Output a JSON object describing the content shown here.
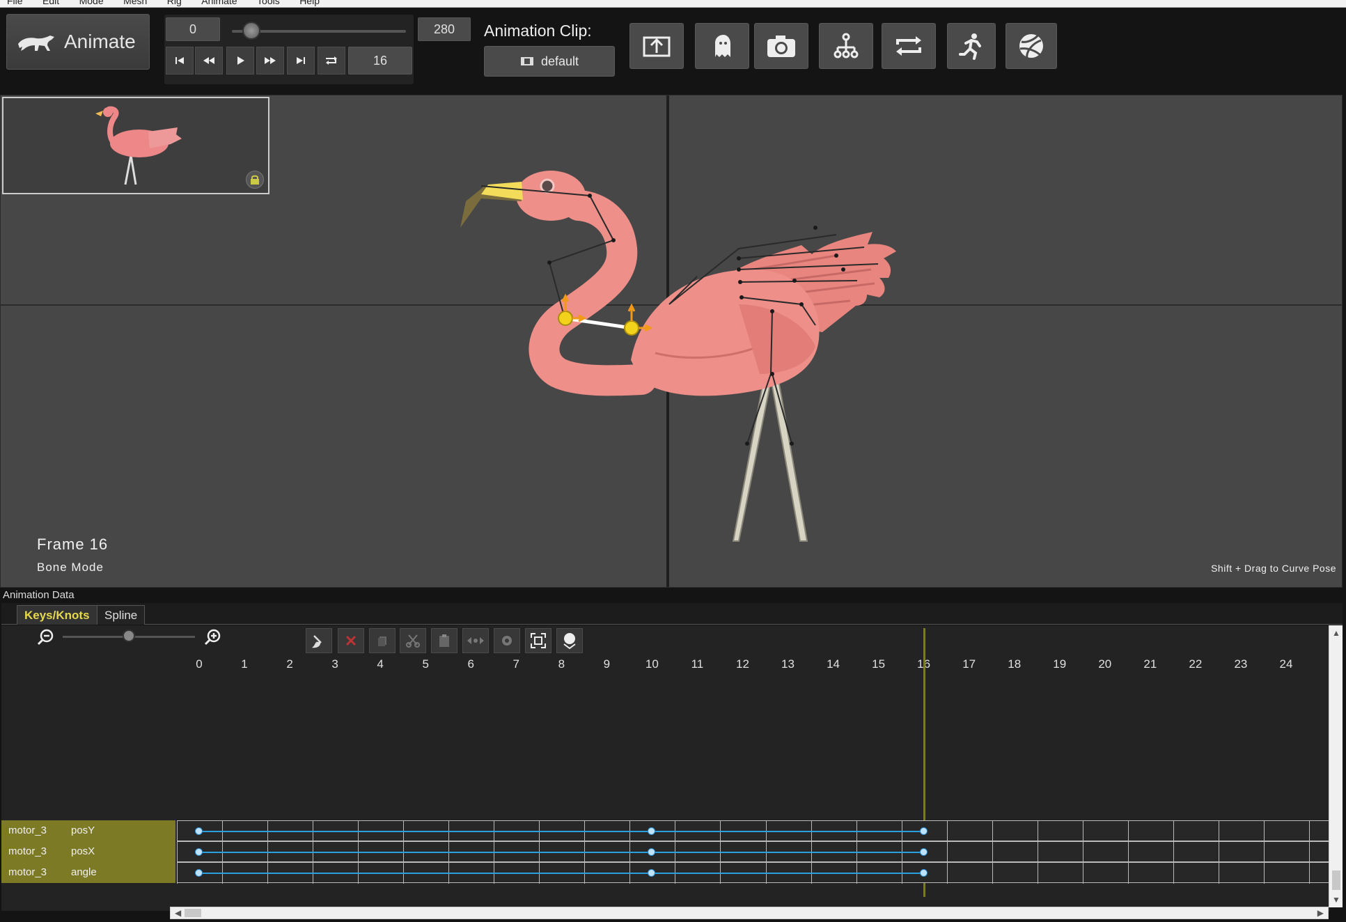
{
  "menubar": {
    "items": [
      "File",
      "Edit",
      "Mode",
      "Mesh",
      "Rig",
      "Animate",
      "Tools",
      "Help"
    ]
  },
  "toolbar": {
    "mode_label": "Animate",
    "range_start": "0",
    "range_end": "280",
    "current_frame": "16",
    "timeline_slider_fraction": 0.11,
    "clip_heading": "Animation Clip:",
    "clip_name": "default",
    "tool_icons": [
      "export-icon",
      "ghost-icon",
      "camera-icon",
      "hierarchy-icon",
      "loop-icon",
      "runner-icon",
      "physics-icon"
    ]
  },
  "viewport": {
    "frame_label": "Frame 16",
    "mode_label": "Bone Mode",
    "hint": "Shift + Drag to Curve Pose"
  },
  "anim_data": {
    "title": "Animation Data",
    "tabs": [
      {
        "label": "Keys/Knots",
        "active": true
      },
      {
        "label": "Spline",
        "active": false
      }
    ],
    "zoom_fraction": 0.5,
    "ruler": [
      "0",
      "1",
      "2",
      "3",
      "4",
      "5",
      "6",
      "7",
      "8",
      "9",
      "10",
      "11",
      "12",
      "13",
      "14",
      "15",
      "16",
      "17",
      "18",
      "19",
      "20",
      "21",
      "22",
      "23",
      "24"
    ],
    "cursor_frame": 16,
    "tracks": [
      {
        "motor": "motor_3",
        "channel": "posY",
        "keys": [
          0,
          10,
          16
        ]
      },
      {
        "motor": "motor_3",
        "channel": "posX",
        "keys": [
          0,
          10,
          16
        ]
      },
      {
        "motor": "motor_3",
        "channel": "angle",
        "keys": [
          0,
          10,
          16
        ]
      }
    ]
  },
  "colors": {
    "accent_yellow": "#e6d94d",
    "track_olive": "#7c7a25",
    "curve_blue": "#2aa0e0",
    "viewport_gray": "#474747"
  }
}
